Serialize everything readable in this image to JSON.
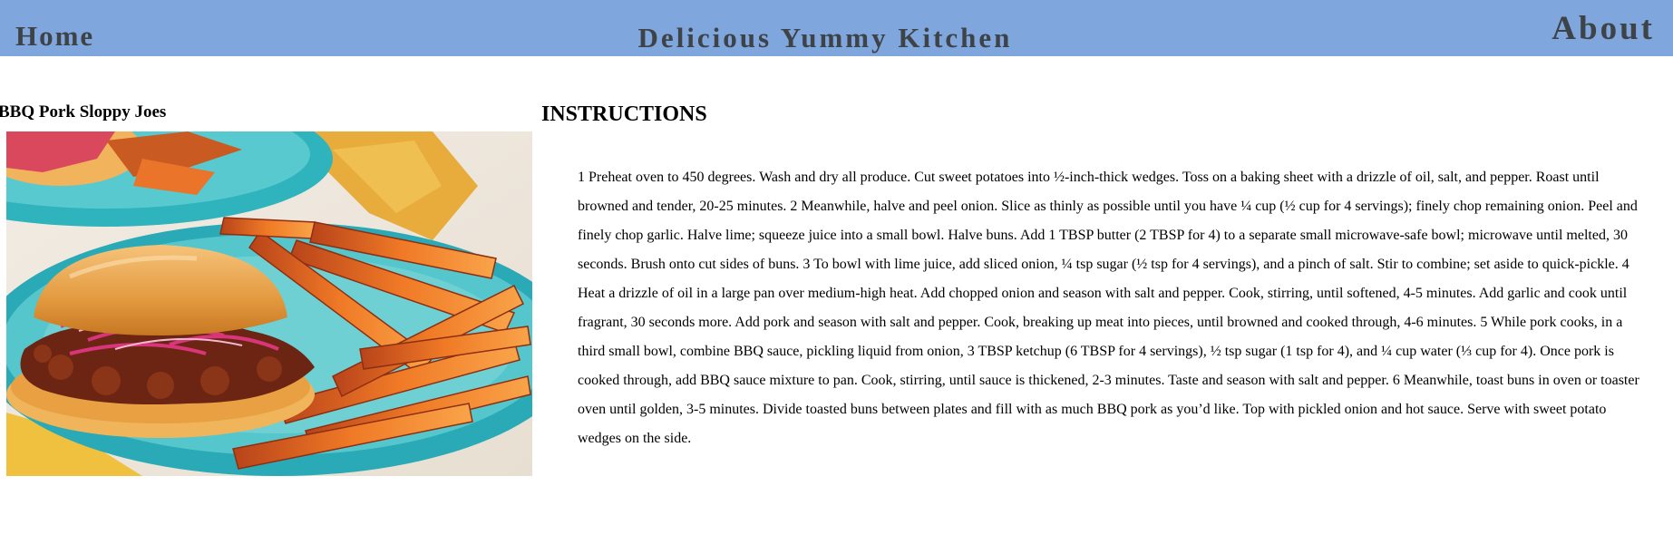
{
  "header": {
    "home_label": "Home",
    "site_title": "Delicious Yummy Kitchen",
    "about_label": "About",
    "background_color": "#7fa6dd",
    "text_color": "#3e4347"
  },
  "recipe": {
    "title": "BBQ Pork Sloppy Joes",
    "image_icon": "bbq-pork-sloppy-joe-photo"
  },
  "instructions": {
    "heading": "INSTRUCTIONS",
    "text": "1 Preheat oven to 450 degrees. Wash and dry all produce. Cut sweet potatoes into ½-inch-thick wedges. Toss on a baking sheet with a drizzle of oil, salt, and pepper. Roast until browned and tender, 20-25 minutes. 2 Meanwhile, halve and peel onion. Slice as thinly as possible until you have ¼ cup (½ cup for 4 servings); finely chop remaining onion. Peel and finely chop garlic. Halve lime; squeeze juice into a small bowl. Halve buns. Add 1 TBSP butter (2 TBSP for 4) to a separate small microwave-safe bowl; microwave until melted, 30 seconds. Brush onto cut sides of buns. 3 To bowl with lime juice, add sliced onion, ¼ tsp sugar (½ tsp for 4 servings), and a pinch of salt. Stir to combine; set aside to quick-pickle. 4 Heat a drizzle of oil in a large pan over medium-high heat. Add chopped onion and season with salt and pepper. Cook, stirring, until softened, 4-5 minutes. Add garlic and cook until fragrant, 30 seconds more. Add pork and season with salt and pepper. Cook, breaking up meat into pieces, until browned and cooked through, 4-6 minutes. 5 While pork cooks, in a third small bowl, combine BBQ sauce, pickling liquid from onion, 3 TBSP ketchup (6 TBSP for 4 servings), ½ tsp sugar (1 tsp for 4), and ¼ cup water (⅓ cup for 4). Once pork is cooked through, add BBQ sauce mixture to pan. Cook, stirring, until sauce is thickened, 2-3 minutes. Taste and season with salt and pepper. 6 Meanwhile, toast buns in oven or toaster oven until golden, 3-5 minutes. Divide toasted buns between plates and fill with as much BBQ pork as you’d like. Top with pickled onion and hot sauce. Serve with sweet potato wedges on the side."
  }
}
